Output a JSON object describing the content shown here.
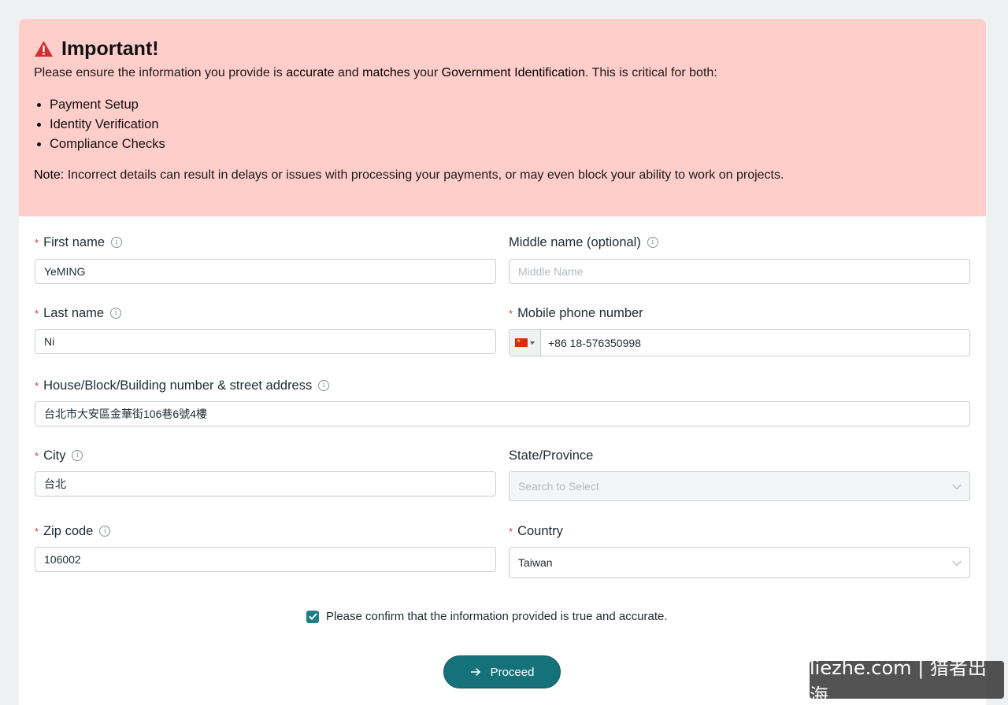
{
  "alert": {
    "title": "Important!",
    "intro_1": "Please ensure the information you provide is ",
    "intro_bold_1": "accurate",
    "intro_2": " and ",
    "intro_bold_2": "matches",
    "intro_3": " your ",
    "intro_bold_3": "Government Identification",
    "intro_4": ". This is critical for both:",
    "bullets": [
      "Payment Setup",
      "Identity Verification",
      "Compliance Checks"
    ],
    "note_label": "Note:",
    "note_text": " Incorrect details can result in delays or issues with processing your payments, or may even block your ability to work on projects."
  },
  "form": {
    "first_name": {
      "required": "*",
      "label": "First name",
      "value": "YeMING"
    },
    "middle_name": {
      "label": "Middle name (optional)",
      "placeholder": "Middle Name"
    },
    "last_name": {
      "required": "*",
      "label": "Last name",
      "value": "Ni"
    },
    "mobile": {
      "required": "*",
      "label": "Mobile phone number",
      "value": "+86 18-576350998"
    },
    "address": {
      "required": "*",
      "label": "House/Block/Building number & street address",
      "value": "台北市大安區金華街106巷6號4樓"
    },
    "city": {
      "required": "*",
      "label": "City",
      "value": "台北"
    },
    "state": {
      "label": "State/Province",
      "placeholder": "Search to Select"
    },
    "zip": {
      "required": "*",
      "label": "Zip code",
      "value": "106002"
    },
    "country": {
      "required": "*",
      "label": "Country",
      "value": "Taiwan"
    }
  },
  "confirm": {
    "label": "Please confirm that the information provided is true and accurate.",
    "checked": true
  },
  "proceed": {
    "label": "Proceed"
  },
  "watermark": {
    "text": "liezhe.com | 猎者出海"
  },
  "icons": {
    "info": "i"
  },
  "colors": {
    "alert_bg": "#ffcdca",
    "primary": "#16727a",
    "required": "#d33a35",
    "warning": "#d32f2f"
  }
}
